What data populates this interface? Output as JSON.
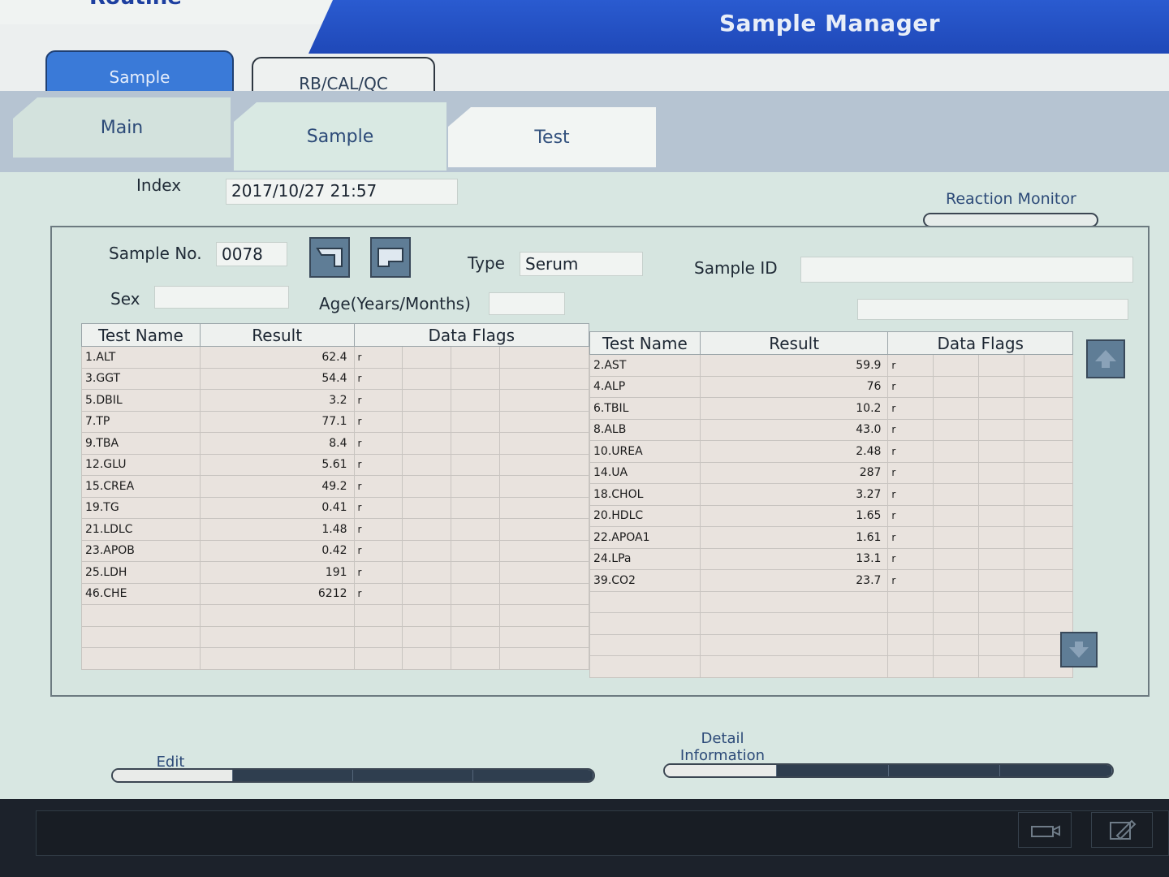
{
  "app": {
    "corner_tab": "Routine",
    "title": "Sample Manager"
  },
  "mode_buttons": {
    "sample": "Sample",
    "rb_cal_qc": "RB/CAL/QC"
  },
  "tabs": {
    "main": "Main",
    "sample": "Sample",
    "test": "Test"
  },
  "index": {
    "label": "Index",
    "value": "2017/10/27 21:57"
  },
  "reaction_monitor": "Reaction Monitor",
  "sample_info": {
    "sample_no_label": "Sample No.",
    "sample_no_value": "0078",
    "type_label": "Type",
    "type_value": "Serum",
    "sample_id_label": "Sample ID",
    "sample_id_value": "",
    "sex_label": "Sex",
    "sex_value": "",
    "age_label": "Age(Years/Months)",
    "age_value": ""
  },
  "table": {
    "headers": {
      "test_name": "Test Name",
      "result": "Result",
      "data_flags": "Data Flags"
    },
    "left_rows": [
      {
        "name": "1.ALT",
        "result": "62.4",
        "flag": "r"
      },
      {
        "name": "3.GGT",
        "result": "54.4",
        "flag": "r"
      },
      {
        "name": "5.DBIL",
        "result": "3.2",
        "flag": "r"
      },
      {
        "name": "7.TP",
        "result": "77.1",
        "flag": "r"
      },
      {
        "name": "9.TBA",
        "result": "8.4",
        "flag": "r"
      },
      {
        "name": "12.GLU",
        "result": "5.61",
        "flag": "r"
      },
      {
        "name": "15.CREA",
        "result": "49.2",
        "flag": "r"
      },
      {
        "name": "19.TG",
        "result": "0.41",
        "flag": "r"
      },
      {
        "name": "21.LDLC",
        "result": "1.48",
        "flag": "r"
      },
      {
        "name": "23.APOB",
        "result": "0.42",
        "flag": "r"
      },
      {
        "name": "25.LDH",
        "result": "191",
        "flag": "r"
      },
      {
        "name": "46.CHE",
        "result": "6212",
        "flag": "r"
      }
    ],
    "right_rows": [
      {
        "name": "2.AST",
        "result": "59.9",
        "flag": "r"
      },
      {
        "name": "4.ALP",
        "result": "76",
        "flag": "r"
      },
      {
        "name": "6.TBIL",
        "result": "10.2",
        "flag": "r"
      },
      {
        "name": "8.ALB",
        "result": "43.0",
        "flag": "r"
      },
      {
        "name": "10.UREA",
        "result": "2.48",
        "flag": "r"
      },
      {
        "name": "14.UA",
        "result": "287",
        "flag": "r"
      },
      {
        "name": "18.CHOL",
        "result": "3.27",
        "flag": "r"
      },
      {
        "name": "20.HDLC",
        "result": "1.65",
        "flag": "r"
      },
      {
        "name": "22.APOA1",
        "result": "1.61",
        "flag": "r"
      },
      {
        "name": "24.LPa",
        "result": "13.1",
        "flag": "r"
      },
      {
        "name": "39.CO2",
        "result": "23.7",
        "flag": "r"
      }
    ]
  },
  "bottom": {
    "edit_label": "Edit",
    "detail_label_line1": "Detail",
    "detail_label_line2": "Information"
  },
  "icons": {
    "previous_sample": "back-arrow-icon",
    "next_sample": "forward-arrow-icon",
    "scroll_up": "arrow-up-icon",
    "scroll_down": "arrow-down-icon",
    "status_left": "printer-icon",
    "status_right": "edit-icon"
  },
  "colors": {
    "title_band": "#1f48b8",
    "active_button": "#3a7ad8",
    "panel_bg": "#d6e5e0",
    "grid_bg": "#e9e3de"
  }
}
